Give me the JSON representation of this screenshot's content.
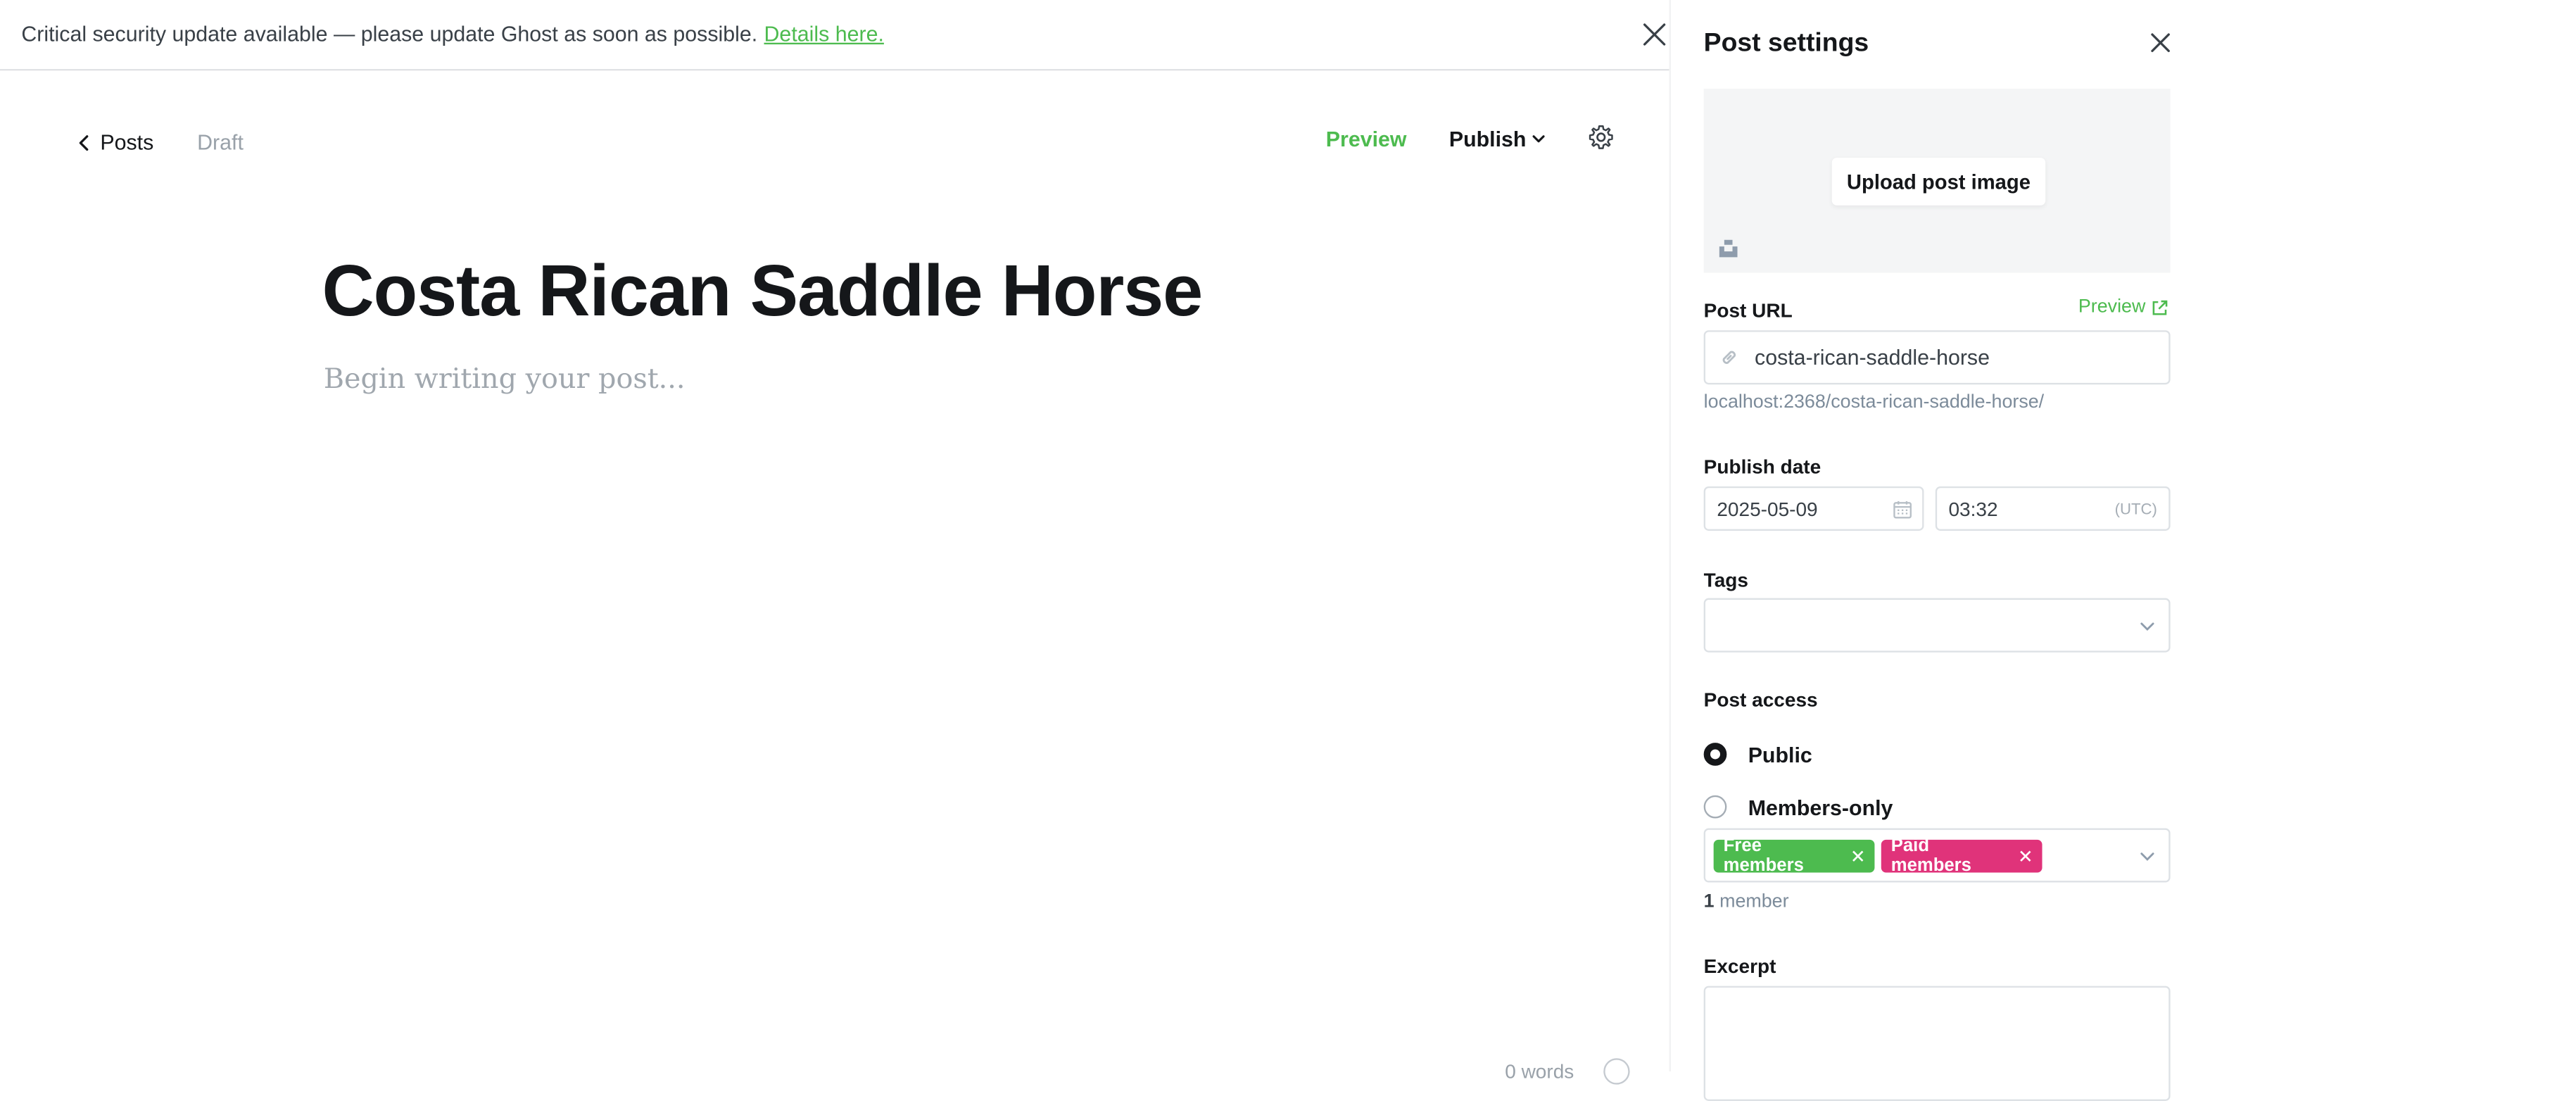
{
  "banner": {
    "message": "Critical security update available — please update Ghost as soon as possible.",
    "link_label": "Details here."
  },
  "editor": {
    "back_label": "Posts",
    "status": "Draft",
    "preview_label": "Preview",
    "publish_label": "Publish",
    "title": "Costa Rican Saddle Horse",
    "body_placeholder": "Begin writing your post...",
    "word_count": "0 words"
  },
  "settings": {
    "title": "Post settings",
    "upload_label": "Upload post image",
    "post_url_label": "Post URL",
    "url_preview_label": "Preview",
    "slug": "costa-rican-saddle-horse",
    "full_url": "localhost:2368/costa-rican-saddle-horse/",
    "publish_date_label": "Publish date",
    "date": "2025-05-09",
    "time": "03:32",
    "timezone": "(UTC)",
    "tags_label": "Tags",
    "post_access_label": "Post access",
    "access_options": [
      {
        "label": "Public",
        "selected": true
      },
      {
        "label": "Members-only",
        "selected": false
      }
    ],
    "segments": [
      {
        "label": "Free members",
        "color": "#4dbb4f"
      },
      {
        "label": "Paid members",
        "color": "#e0337a"
      }
    ],
    "member_count_number": "1",
    "member_count_suffix": "member",
    "excerpt_label": "Excerpt"
  },
  "colors": {
    "accent_green": "#4dbb4f",
    "paid_pink": "#e0337a",
    "text_dark": "#15171a"
  }
}
